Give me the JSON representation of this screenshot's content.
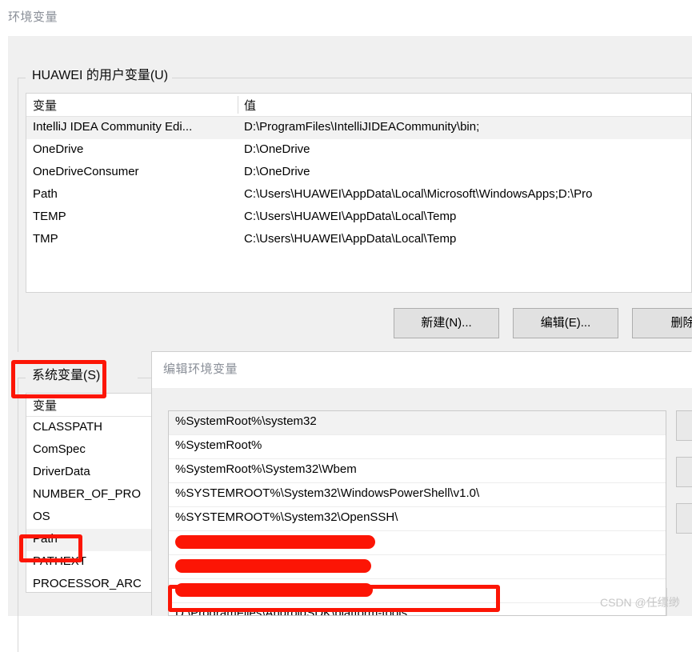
{
  "main_window": {
    "title": "环境变量",
    "user_group": {
      "label": "HUAWEI 的用户变量(U)",
      "columns": [
        "变量",
        "值"
      ],
      "rows": [
        {
          "variable": "IntelliJ IDEA Community Edi...",
          "value": "D:\\ProgramFiles\\IntelliJIDEACommunity\\bin;",
          "selected": true
        },
        {
          "variable": "OneDrive",
          "value": "D:\\OneDrive",
          "selected": false
        },
        {
          "variable": "OneDriveConsumer",
          "value": "D:\\OneDrive",
          "selected": false
        },
        {
          "variable": "Path",
          "value": "C:\\Users\\HUAWEI\\AppData\\Local\\Microsoft\\WindowsApps;D:\\Pro",
          "selected": false
        },
        {
          "variable": "TEMP",
          "value": "C:\\Users\\HUAWEI\\AppData\\Local\\Temp",
          "selected": false
        },
        {
          "variable": "TMP",
          "value": "C:\\Users\\HUAWEI\\AppData\\Local\\Temp",
          "selected": false
        }
      ]
    },
    "buttons": {
      "new": "新建(N)...",
      "edit": "编辑(E)...",
      "delete": "删除("
    },
    "sys_group": {
      "label": "系统变量(S)",
      "columns": [
        "变量"
      ],
      "rows": [
        {
          "variable": "CLASSPATH",
          "selected": false
        },
        {
          "variable": "ComSpec",
          "selected": false
        },
        {
          "variable": "DriverData",
          "selected": false
        },
        {
          "variable": "NUMBER_OF_PRO",
          "selected": false
        },
        {
          "variable": "OS",
          "selected": false
        },
        {
          "variable": "Path",
          "selected": true
        },
        {
          "variable": "PATHEXT",
          "selected": false
        },
        {
          "variable": "PROCESSOR_ARC",
          "selected": false
        }
      ]
    }
  },
  "edit_dialog": {
    "title": "编辑环境变量",
    "rows": [
      {
        "text": "%SystemRoot%\\system32",
        "selected": true,
        "redacted": false
      },
      {
        "text": "%SystemRoot%",
        "selected": false,
        "redacted": false
      },
      {
        "text": "%SystemRoot%\\System32\\Wbem",
        "selected": false,
        "redacted": false
      },
      {
        "text": "%SYSTEMROOT%\\System32\\WindowsPowerShell\\v1.0\\",
        "selected": false,
        "redacted": false
      },
      {
        "text": "%SYSTEMROOT%\\System32\\OpenSSH\\",
        "selected": false,
        "redacted": false
      },
      {
        "text": "",
        "selected": false,
        "redacted": true,
        "redaction_width": 250
      },
      {
        "text": "",
        "selected": false,
        "redacted": true,
        "redaction_width": 245
      },
      {
        "text": "",
        "selected": false,
        "redacted": true,
        "redaction_width": 247
      },
      {
        "text": "D:\\ProgramFiles\\AndroidSDK\\platform-tools",
        "selected": false,
        "redacted": false
      }
    ],
    "side_buttons": [
      "",
      "",
      "",
      ""
    ]
  },
  "annotations": {
    "highlight_color": "#fc1505",
    "boxes": [
      "系统变量(S)",
      "Path",
      "D:\\ProgramFiles\\AndroidSDK\\platform-tools"
    ]
  },
  "watermark": "CSDN @任缥缈"
}
